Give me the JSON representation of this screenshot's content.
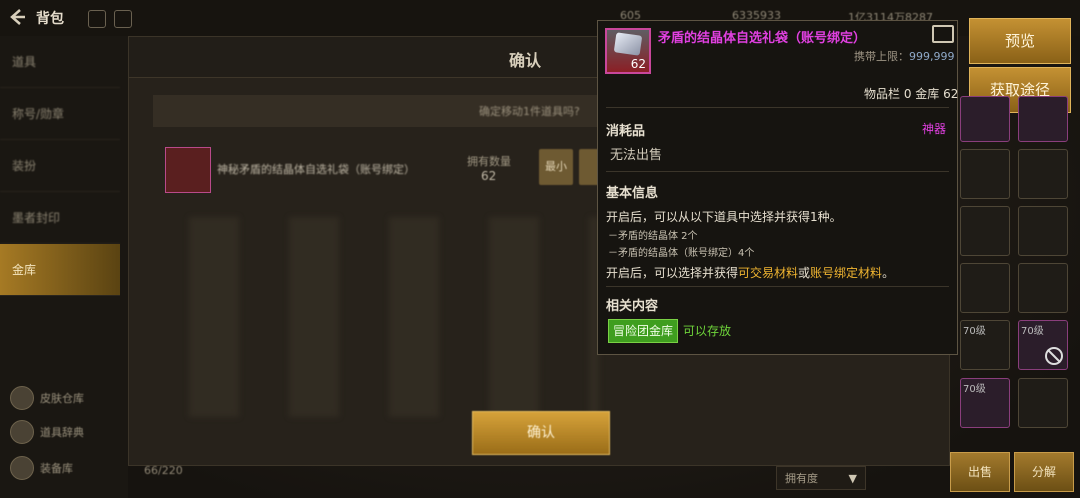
{
  "header": {
    "title": "背包",
    "res1": "605",
    "res2": "6335933",
    "res3": "1亿3114万8287"
  },
  "sidebar": {
    "items": [
      {
        "label": "道具"
      },
      {
        "label": "称号/勋章"
      },
      {
        "label": "装扮"
      },
      {
        "label": "墨者封印"
      },
      {
        "label": "金库"
      }
    ],
    "bottom": [
      {
        "label": "皮肤仓库"
      },
      {
        "label": "道具辞典"
      },
      {
        "label": "装备库"
      }
    ]
  },
  "dialog": {
    "title": "确认",
    "message": "确定移动1件道具吗?",
    "item_name": "神秘矛盾的结晶体自选礼袋（账号绑定）",
    "owned_label": "拥有数量",
    "owned_value": "62",
    "min_label": "最小",
    "confirm_label": "确认"
  },
  "footer": {
    "text": "66/220",
    "sort_label": "拥有度"
  },
  "right": {
    "preview_label": "预览",
    "source_label": "获取途径",
    "sell_label": "出售",
    "disassemble_label": "分解",
    "slot_level": "70级"
  },
  "tooltip": {
    "name": "矛盾的结晶体自选礼袋（账号绑定）",
    "quantity": "62",
    "limit_label": "携带上限：",
    "limit_value": "999,999",
    "storage": "物品栏 0 金库 62",
    "type": "消耗品",
    "rarity": "神器",
    "sell": "无法出售",
    "basic_info_title": "基本信息",
    "desc1": "开启后，可以从以下道具中选择并获得1种。",
    "opt1": "－矛盾的结晶体 2个",
    "opt2": "－矛盾的结晶体（账号绑定）4个",
    "desc2_pre": "开启后，可以选择并获得",
    "desc2_hl1": "可交易材料",
    "desc2_mid": "或",
    "desc2_hl2": "账号绑定材料",
    "desc2_end": "。",
    "related_title": "相关内容",
    "badge": "冒险团金库",
    "badge_note": "可以存放"
  },
  "colors": {
    "rarity": "#e040e0",
    "highlight": "#f0b531",
    "accent_gold": "#c49133"
  }
}
